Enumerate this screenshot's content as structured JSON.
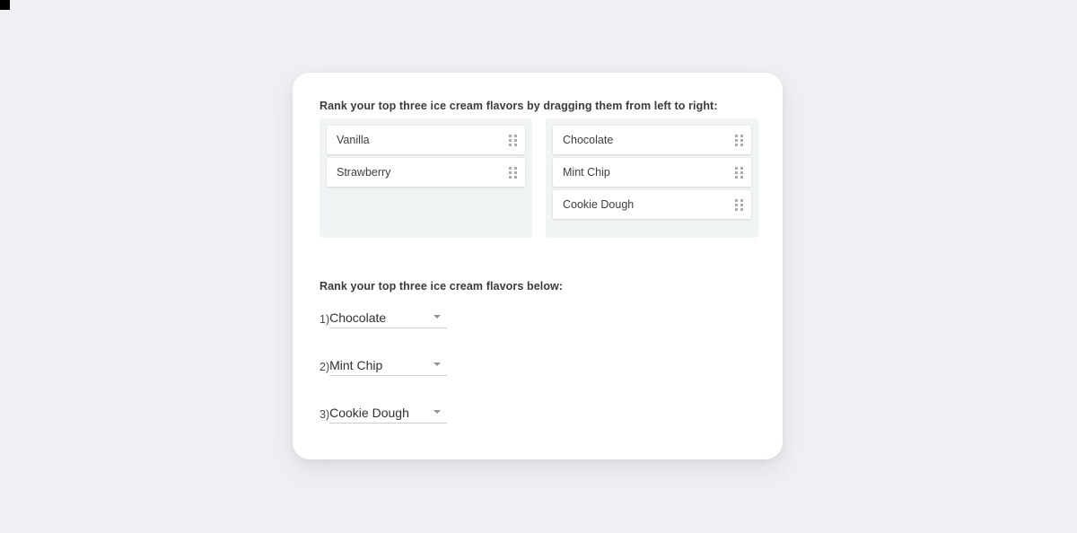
{
  "page": {
    "background_color": "#eff0f4",
    "card_background": "#ffffff"
  },
  "drag_section": {
    "heading": "Rank your top three ice cream flavors by dragging them from left to right:",
    "handle_icon": "drag-handle-icon",
    "zones": [
      {
        "name": "source-list",
        "background_color": "#f1f4f4",
        "items": [
          {
            "label": "Vanilla"
          },
          {
            "label": "Strawberry"
          }
        ]
      },
      {
        "name": "ranked-list",
        "background_color": "#f1f4f4",
        "items": [
          {
            "label": "Chocolate"
          },
          {
            "label": "Mint Chip"
          },
          {
            "label": "Cookie Dough"
          }
        ]
      }
    ]
  },
  "select_section": {
    "heading": "Rank your top three ice cream flavors below:",
    "caret_icon": "chevron-down-icon",
    "rows": [
      {
        "index": "1)",
        "value": "Chocolate"
      },
      {
        "index": "2)",
        "value": "Mint Chip"
      },
      {
        "index": "3)",
        "value": "Cookie Dough"
      }
    ]
  }
}
